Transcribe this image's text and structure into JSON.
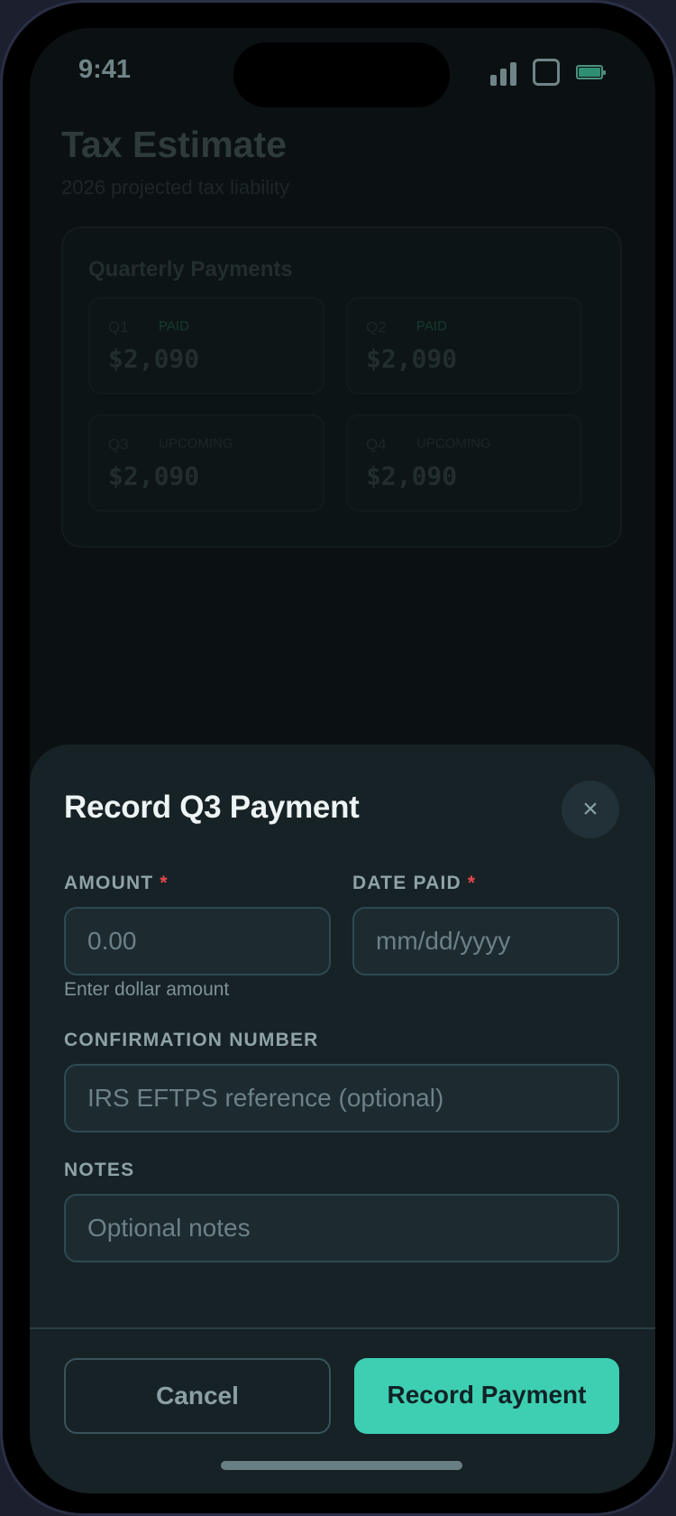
{
  "status_bar": {
    "time": "9:41"
  },
  "background_page": {
    "title": "Tax Estimate",
    "subtitle": "2026 projected tax liability",
    "card_title": "Quarterly Payments",
    "quarters": [
      {
        "label": "Q1",
        "badge": "PAID",
        "amount": "$2,090"
      },
      {
        "label": "Q2",
        "badge": "PAID",
        "amount": "$2,090"
      },
      {
        "label": "Q3",
        "badge": "UPCOMING",
        "amount": "$2,090"
      },
      {
        "label": "Q4",
        "badge": "UPCOMING",
        "amount": "$2,090"
      }
    ]
  },
  "sheet": {
    "title": "Record Q3 Payment",
    "close_icon": "×",
    "amount": {
      "label": "AMOUNT",
      "required": "*",
      "placeholder": "0.00",
      "hint": "Enter dollar amount"
    },
    "date": {
      "label": "DATE PAID",
      "required": "*",
      "placeholder": "mm/dd/yyyy"
    },
    "confirmation": {
      "label": "CONFIRMATION NUMBER",
      "placeholder": "IRS EFTPS reference (optional)"
    },
    "notes": {
      "label": "NOTES",
      "placeholder": "Optional notes"
    },
    "cancel_label": "Cancel",
    "submit_label": "Record Payment"
  },
  "colors": {
    "accent": "#3ecfb2",
    "required": "#e5484d",
    "sheet_bg": "#172226"
  }
}
